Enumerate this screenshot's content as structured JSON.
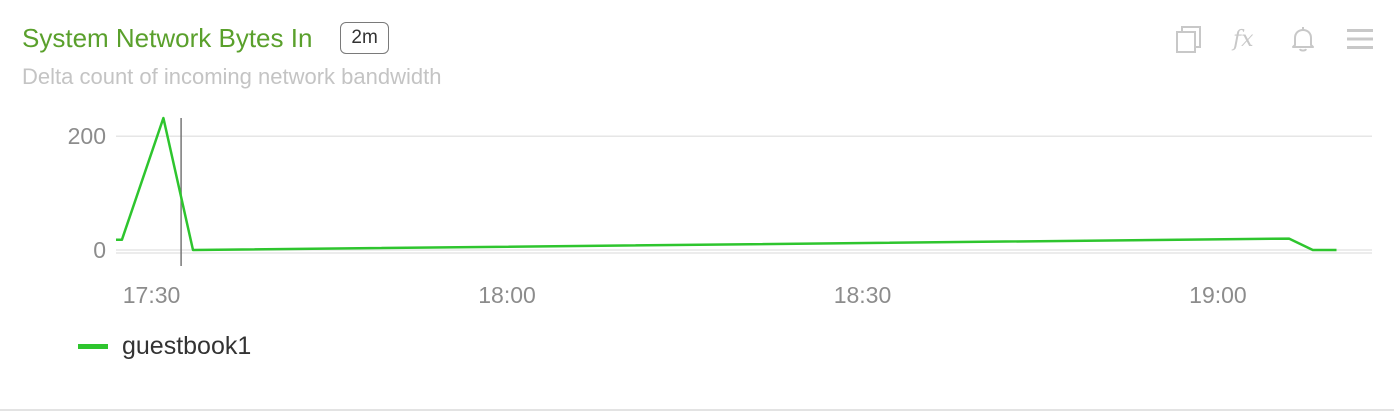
{
  "panel": {
    "title": "System Network Bytes In",
    "time_range": "2m",
    "subtitle": "Delta count of incoming network bandwidth",
    "toolbar": [
      {
        "icon": "copy-icon"
      },
      {
        "icon": "function-icon",
        "label": "fx"
      },
      {
        "icon": "bell-icon"
      },
      {
        "icon": "menu-icon"
      }
    ]
  },
  "colors": {
    "title": "#5aa02c",
    "series": "#2ec52e",
    "grid": "#e6e6e6",
    "axis_text": "#8c8c8c"
  },
  "chart_data": {
    "type": "line",
    "xlim": [
      "17:27",
      "19:13"
    ],
    "ylim": [
      0,
      232
    ],
    "x_ticks": [
      "17:30",
      "18:00",
      "18:30",
      "19:00"
    ],
    "y_ticks": [
      0,
      200
    ],
    "grid": true,
    "legend_position": "bottom-left",
    "cursor_time": "17:33",
    "series": [
      {
        "name": "guestbook1",
        "color": "#2ec52e",
        "points": [
          {
            "x": "17:27",
            "y": 18
          },
          {
            "x": "17:27:30",
            "y": 18
          },
          {
            "x": "17:31",
            "y": 232
          },
          {
            "x": "17:33:30",
            "y": 0
          },
          {
            "x": "19:06",
            "y": 20
          },
          {
            "x": "19:08",
            "y": 0
          },
          {
            "x": "19:10",
            "y": 0
          }
        ]
      }
    ]
  }
}
